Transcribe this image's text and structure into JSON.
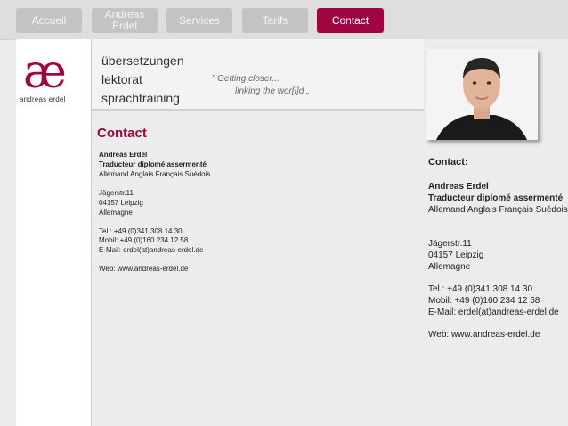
{
  "nav": {
    "items": [
      "Accueil",
      "Andreas\nErdel",
      "Services",
      "Tarifs",
      "Contact"
    ],
    "active": "Contact",
    "accent": "#a00541"
  },
  "logo": {
    "mark": "æ",
    "name": "andreas erdel"
  },
  "services": [
    "übersetzungen",
    "lektorat",
    "sprachtraining"
  ],
  "tagline": {
    "line1": "” Getting closer...",
    "line2": "linking the wor[l]d „"
  },
  "contact": {
    "heading": "Contact",
    "name": "Andreas Erdel",
    "title": "Traducteur diplomé assermenté",
    "languages": "Allemand Anglais Français Suédois",
    "street": "Jägerstr.11",
    "city": "04157 Leipzig",
    "country": "Allemagne",
    "tel": "Tel.: +49 (0)341 308 14 30",
    "mobil": "Mobil: +49 (0)160 234 12 58",
    "email": "E-Mail: erdel(at)andreas-erdel.de",
    "web": "Web: www.andreas-erdel.de"
  },
  "sidebar": {
    "heading": "Contact:"
  }
}
